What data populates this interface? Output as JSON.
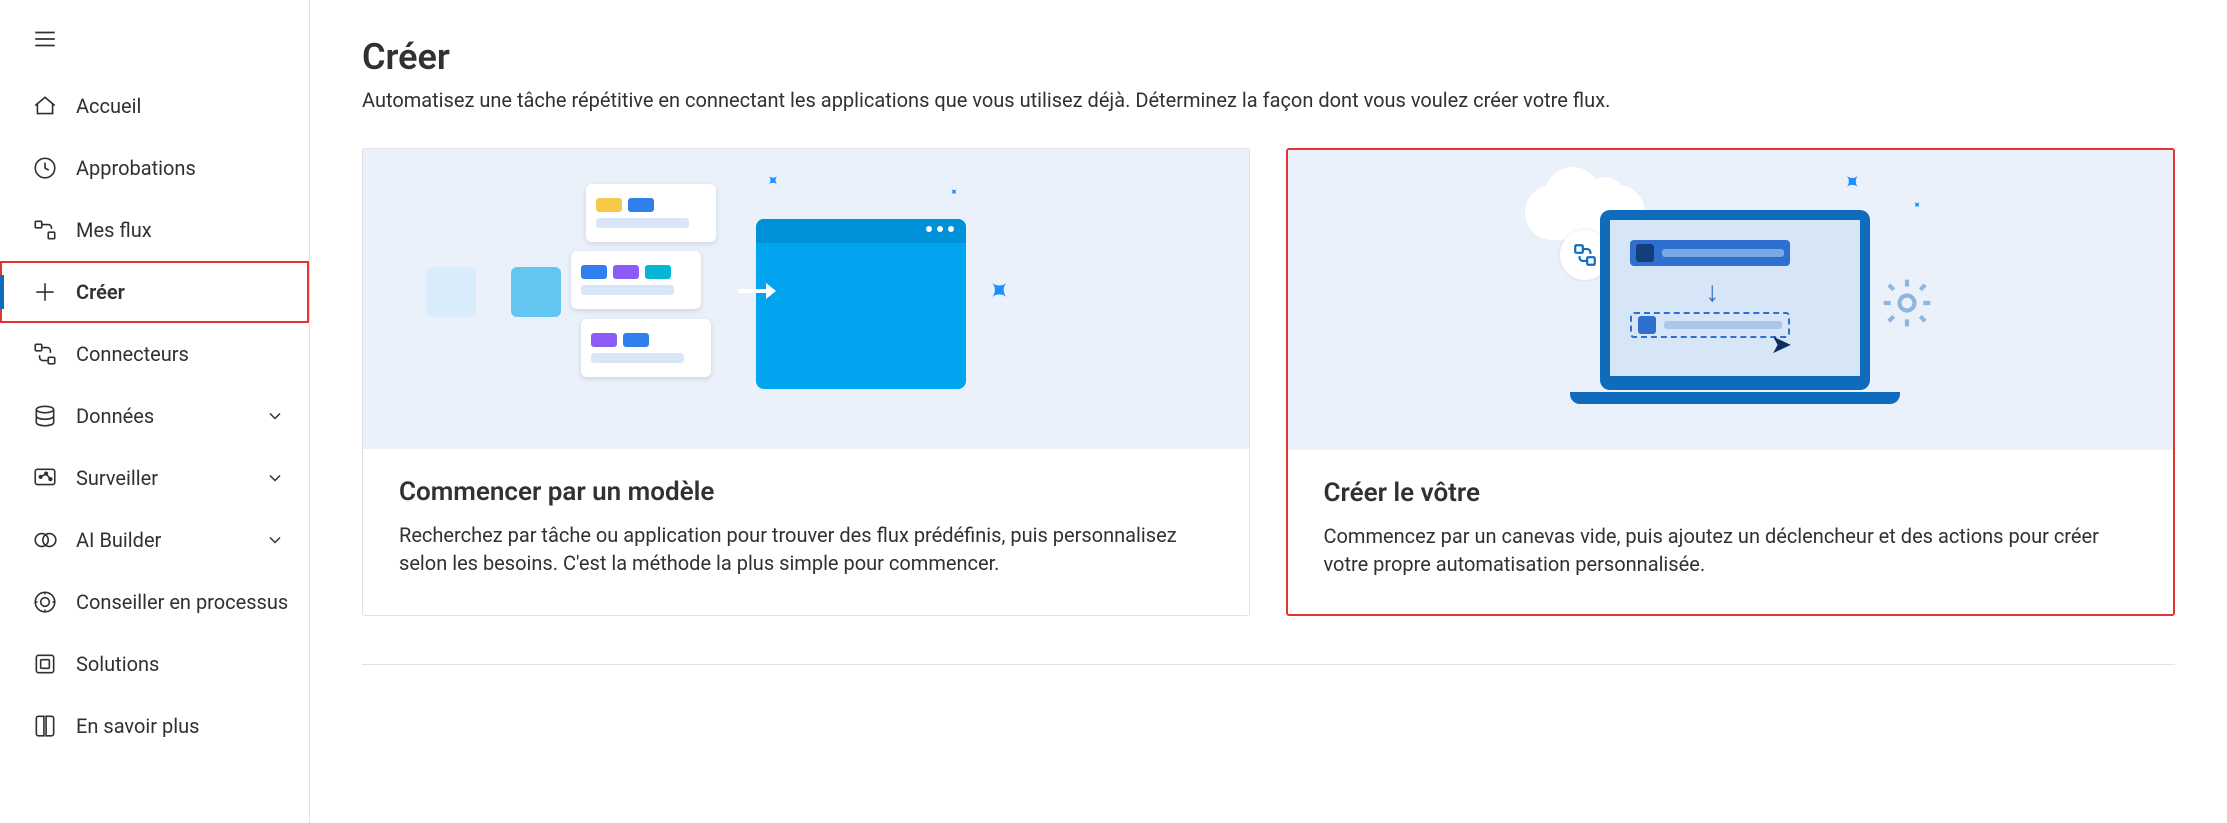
{
  "sidebar": {
    "items": [
      {
        "key": "home",
        "label": "Accueil",
        "icon": "home-icon",
        "chevron": false,
        "active": false,
        "highlighted": false
      },
      {
        "key": "approvals",
        "label": "Approbations",
        "icon": "approval-icon",
        "chevron": false,
        "active": false,
        "highlighted": false
      },
      {
        "key": "myflows",
        "label": "Mes flux",
        "icon": "flow-icon",
        "chevron": false,
        "active": false,
        "highlighted": false
      },
      {
        "key": "create",
        "label": "Créer",
        "icon": "plus-icon",
        "chevron": false,
        "active": true,
        "highlighted": true
      },
      {
        "key": "connectors",
        "label": "Connecteurs",
        "icon": "connector-icon",
        "chevron": false,
        "active": false,
        "highlighted": false
      },
      {
        "key": "data",
        "label": "Données",
        "icon": "data-icon",
        "chevron": true,
        "active": false,
        "highlighted": false
      },
      {
        "key": "monitor",
        "label": "Surveiller",
        "icon": "monitor-icon",
        "chevron": true,
        "active": false,
        "highlighted": false
      },
      {
        "key": "aibuilder",
        "label": "AI Builder",
        "icon": "aibuilder-icon",
        "chevron": true,
        "active": false,
        "highlighted": false
      },
      {
        "key": "advisor",
        "label": "Conseiller en processus",
        "icon": "advisor-icon",
        "chevron": false,
        "active": false,
        "highlighted": false
      },
      {
        "key": "solutions",
        "label": "Solutions",
        "icon": "solutions-icon",
        "chevron": false,
        "active": false,
        "highlighted": false
      },
      {
        "key": "learn",
        "label": "En savoir plus",
        "icon": "learn-icon",
        "chevron": false,
        "active": false,
        "highlighted": false
      }
    ]
  },
  "page": {
    "title": "Créer",
    "subtitle": "Automatisez une tâche répétitive en connectant les applications que vous utilisez déjà. Déterminez la façon dont vous voulez créer votre flux."
  },
  "cards": [
    {
      "key": "template",
      "title": "Commencer par un modèle",
      "desc": "Recherchez par tâche ou application pour trouver des flux prédéfinis, puis personnalisez selon les besoins. C'est la méthode la plus simple pour commencer.",
      "highlighted": false
    },
    {
      "key": "blank",
      "title": "Créer le vôtre",
      "desc": "Commencez par un canevas vide, puis ajoutez un déclencheur et des actions pour créer votre propre automatisation personnalisée.",
      "highlighted": true
    }
  ]
}
